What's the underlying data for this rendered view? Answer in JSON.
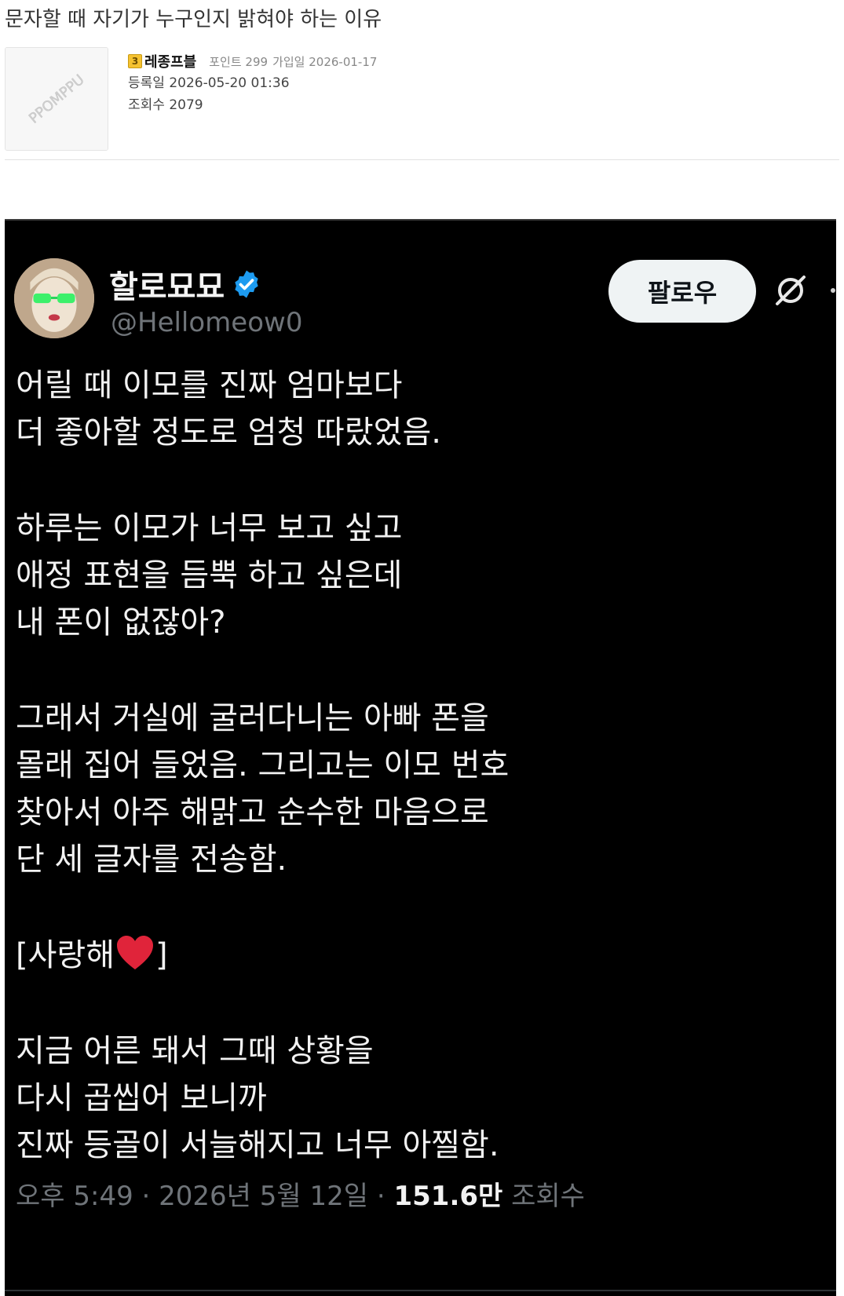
{
  "post": {
    "title": "문자할 때 자기가 누구인지 밝혀야 하는 이유"
  },
  "author": {
    "level": "3",
    "nickname": "레종프블",
    "points_label": "포인트 299",
    "joined_label": "가입일 2026-01-17",
    "registered_label": "등록일 2026-05-20 01:36",
    "views_label": "조회수 2079",
    "watermark": "PPOMPPU"
  },
  "tweet": {
    "display_name": "할로묘묘",
    "handle": "@Hellomeow0",
    "follow_label": "팔로우",
    "paragraphs": [
      [
        "어릴 때 이모를 진짜 엄마보다",
        "더 좋아할 정도로 엄청 따랐었음."
      ],
      [
        "하루는 이모가 너무 보고 싶고",
        "애정 표현을 듬뿍 하고 싶은데",
        "내 폰이 없잖아?"
      ],
      [
        "그래서 거실에 굴러다니는 아빠 폰을",
        "몰래 집어 들었음. 그리고는 이모 번호",
        "찾아서 아주 해맑고 순수한 마음으로",
        "단 세 글자를 전송함."
      ],
      [
        "[사랑해❤️]"
      ],
      [
        "지금 어른 돼서 그때 상황을",
        "다시 곱씹어 보니까",
        "진짜 등골이 서늘해지고 너무 아찔함."
      ]
    ],
    "message_open": "[사랑해",
    "message_close": "]",
    "time": "오후 5:49",
    "date": "2026년 5월 12일",
    "views_count": "151.6만",
    "views_label": "조회수",
    "separator": "·"
  },
  "colors": {
    "verified_blue": "#1d9bf0",
    "heart_red": "#e0243a",
    "tweet_bg": "#000000",
    "muted": "#6f7479"
  }
}
